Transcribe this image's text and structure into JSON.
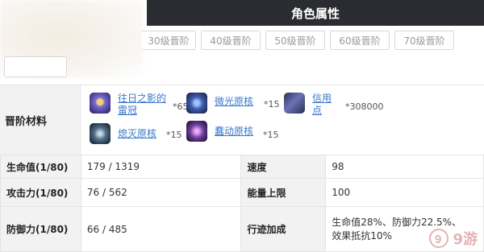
{
  "header": {
    "title": "角色属性"
  },
  "tabs": [
    "30级晋阶",
    "40级晋阶",
    "50级晋阶",
    "60级晋阶",
    "70级晋阶"
  ],
  "materials": {
    "label": "晋阶材料",
    "items": [
      {
        "name": "往日之影的雷冠",
        "count": "*65",
        "icon": "thunder-crown-icon",
        "color": "#5b4fb8"
      },
      {
        "name": "微光原核",
        "count": "*15",
        "icon": "glimmer-core-icon",
        "color": "#3f5fb0"
      },
      {
        "name": "信用点",
        "count": "*308000",
        "icon": "credit-icon",
        "color": "#4a4f7a"
      },
      {
        "name": "熄灭原核",
        "count": "*15",
        "icon": "extinguished-core-icon",
        "color": "#4f6f8a"
      },
      {
        "name": "蠢动原核",
        "count": "*15",
        "icon": "squirming-core-icon",
        "color": "#6a3f9a"
      }
    ]
  },
  "stats": {
    "rows": [
      {
        "label1": "生命值(1/80)",
        "value1": "179 / 1319",
        "label2": "速度",
        "value2": "98"
      },
      {
        "label1": "攻击力(1/80)",
        "value1": "76 / 562",
        "label2": "能量上限",
        "value2": "100"
      },
      {
        "label1": "防御力(1/80)",
        "value1": "66 / 485",
        "label2": "行迹加成",
        "value2_line1": "生命值28%、防御力22.5%、",
        "value2_line2": "效果抵抗10%"
      }
    ]
  },
  "watermark": {
    "text": "9游"
  }
}
